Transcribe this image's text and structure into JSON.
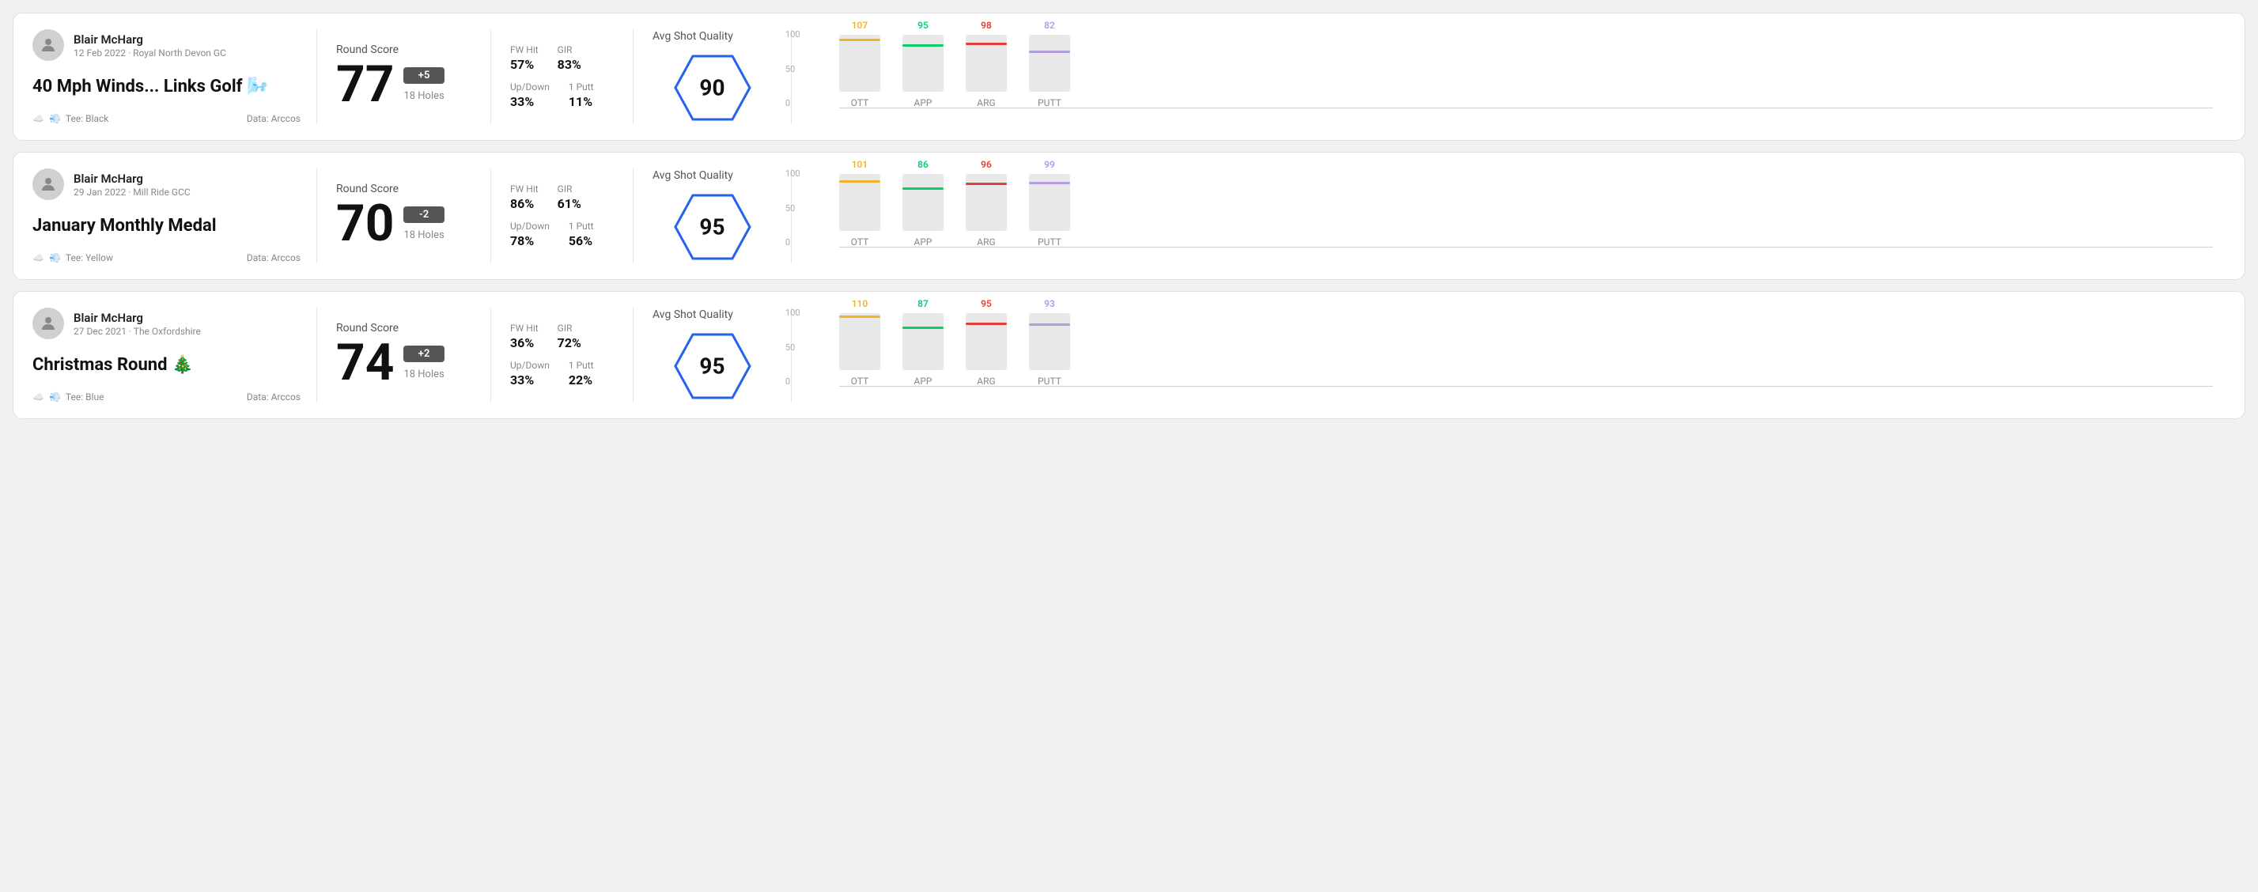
{
  "rounds": [
    {
      "id": "round-1",
      "user": {
        "name": "Blair McHarg",
        "meta": "12 Feb 2022 · Royal North Devon GC"
      },
      "title": "40 Mph Winds... Links Golf",
      "title_emoji": "🌬️",
      "tee": "Black",
      "data_source": "Data: Arccos",
      "score": {
        "label": "Round Score",
        "number": "77",
        "badge": "+5",
        "badge_type": "positive",
        "holes": "18 Holes"
      },
      "stats": {
        "fw_hit_label": "FW Hit",
        "fw_hit_value": "57%",
        "gir_label": "GIR",
        "gir_value": "83%",
        "updown_label": "Up/Down",
        "updown_value": "33%",
        "putt_label": "1 Putt",
        "putt_value": "11%"
      },
      "quality": {
        "label": "Avg Shot Quality",
        "score": "90"
      },
      "chart": {
        "bars": [
          {
            "label": "OTT",
            "value": 107,
            "color": "#f0b429",
            "max": 120
          },
          {
            "label": "APP",
            "value": 95,
            "color": "#0cce6b",
            "max": 120
          },
          {
            "label": "ARG",
            "value": 98,
            "color": "#e03e3e",
            "max": 120
          },
          {
            "label": "PUTT",
            "value": 82,
            "color": "#b39ddb",
            "max": 120
          }
        ]
      }
    },
    {
      "id": "round-2",
      "user": {
        "name": "Blair McHarg",
        "meta": "29 Jan 2022 · Mill Ride GCC"
      },
      "title": "January Monthly Medal",
      "title_emoji": "",
      "tee": "Yellow",
      "data_source": "Data: Arccos",
      "score": {
        "label": "Round Score",
        "number": "70",
        "badge": "-2",
        "badge_type": "negative",
        "holes": "18 Holes"
      },
      "stats": {
        "fw_hit_label": "FW Hit",
        "fw_hit_value": "86%",
        "gir_label": "GIR",
        "gir_value": "61%",
        "updown_label": "Up/Down",
        "updown_value": "78%",
        "putt_label": "1 Putt",
        "putt_value": "56%"
      },
      "quality": {
        "label": "Avg Shot Quality",
        "score": "95"
      },
      "chart": {
        "bars": [
          {
            "label": "OTT",
            "value": 101,
            "color": "#f0b429",
            "max": 120
          },
          {
            "label": "APP",
            "value": 86,
            "color": "#0cce6b",
            "max": 120
          },
          {
            "label": "ARG",
            "value": 96,
            "color": "#e03e3e",
            "max": 120
          },
          {
            "label": "PUTT",
            "value": 99,
            "color": "#b39ddb",
            "max": 120
          }
        ]
      }
    },
    {
      "id": "round-3",
      "user": {
        "name": "Blair McHarg",
        "meta": "27 Dec 2021 · The Oxfordshire"
      },
      "title": "Christmas Round",
      "title_emoji": "🎄",
      "tee": "Blue",
      "data_source": "Data: Arccos",
      "score": {
        "label": "Round Score",
        "number": "74",
        "badge": "+2",
        "badge_type": "positive",
        "holes": "18 Holes"
      },
      "stats": {
        "fw_hit_label": "FW Hit",
        "fw_hit_value": "36%",
        "gir_label": "GIR",
        "gir_value": "72%",
        "updown_label": "Up/Down",
        "updown_value": "33%",
        "putt_label": "1 Putt",
        "putt_value": "22%"
      },
      "quality": {
        "label": "Avg Shot Quality",
        "score": "95"
      },
      "chart": {
        "bars": [
          {
            "label": "OTT",
            "value": 110,
            "color": "#f0b429",
            "max": 120
          },
          {
            "label": "APP",
            "value": 87,
            "color": "#0cce6b",
            "max": 120
          },
          {
            "label": "ARG",
            "value": 95,
            "color": "#e03e3e",
            "max": 120
          },
          {
            "label": "PUTT",
            "value": 93,
            "color": "#b39ddb",
            "max": 120
          }
        ]
      }
    }
  ],
  "chart_y_labels": [
    "100",
    "50",
    "0"
  ]
}
